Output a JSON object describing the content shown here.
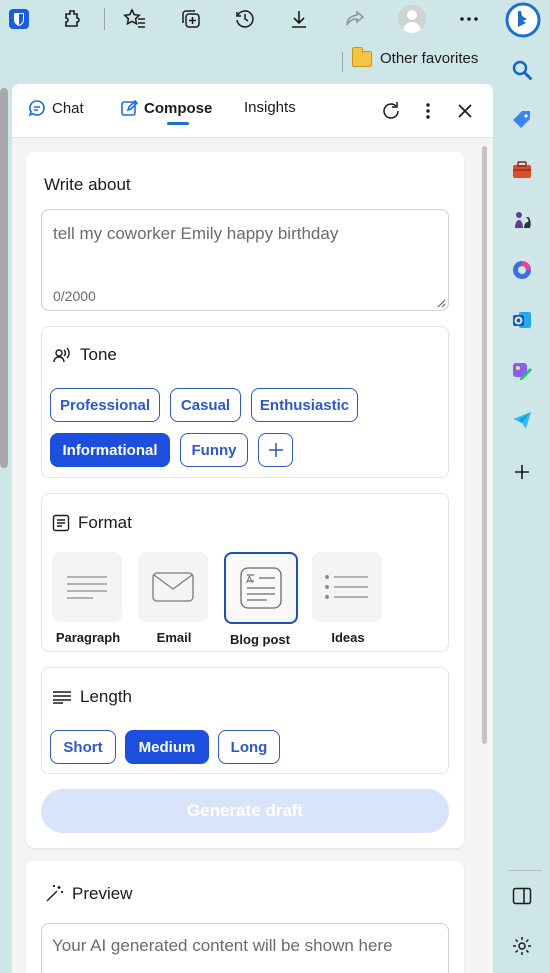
{
  "favorites": {
    "other_favorites": "Other favorites"
  },
  "panel": {
    "tabs": {
      "chat": "Chat",
      "compose": "Compose",
      "insights": "Insights"
    },
    "write_about": {
      "label": "Write about",
      "placeholder": "tell my coworker Emily happy birthday",
      "counter": "0/2000"
    },
    "tone": {
      "title": "Tone",
      "options": [
        "Professional",
        "Casual",
        "Enthusiastic",
        "Informational",
        "Funny"
      ],
      "selected": "Informational"
    },
    "format": {
      "title": "Format",
      "options": [
        "Paragraph",
        "Email",
        "Blog post",
        "Ideas"
      ],
      "selected": "Blog post"
    },
    "length": {
      "title": "Length",
      "options": [
        "Short",
        "Medium",
        "Long"
      ],
      "selected": "Medium"
    },
    "generate_label": "Generate draft",
    "preview": {
      "title": "Preview",
      "placeholder": "Your AI generated content will be shown here"
    }
  },
  "colors": {
    "accent": "#1c4fdd",
    "chip_border": "#2d59c8",
    "browser_bg": "#cfe6e8",
    "generate_disabled": "#d9e4fb"
  }
}
